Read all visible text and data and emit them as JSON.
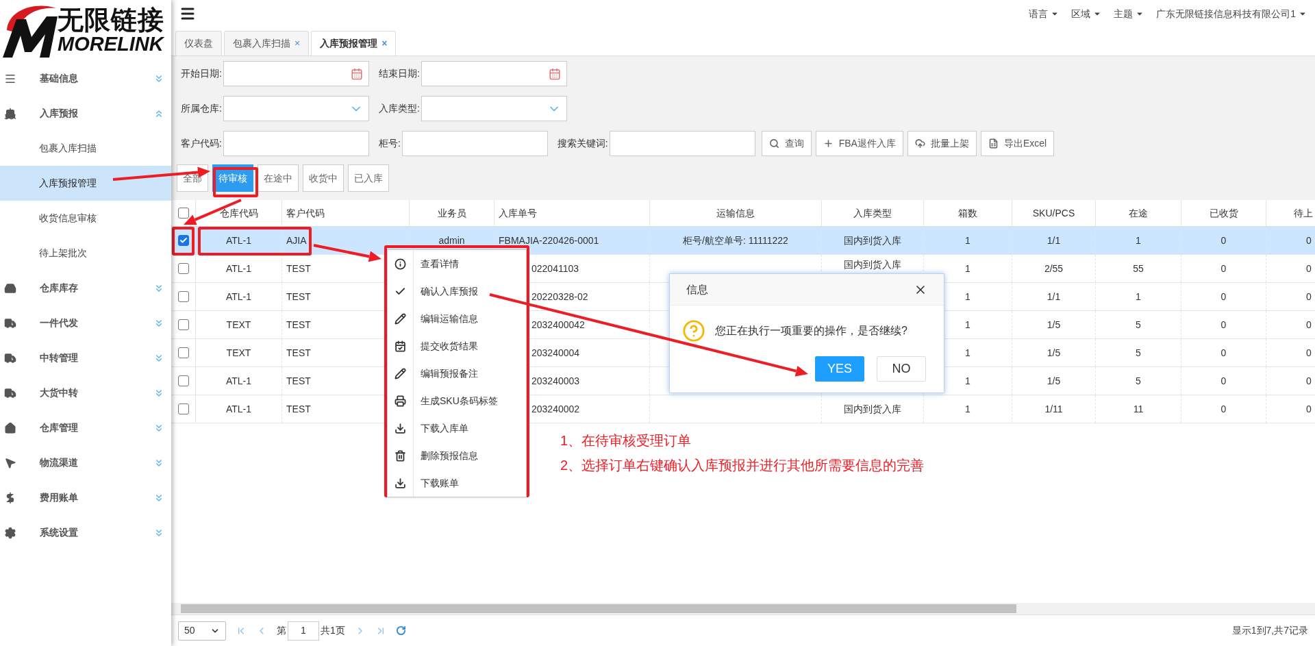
{
  "logo": {
    "title": "无限链接",
    "subtitle": "MORELINK"
  },
  "sidebar": {
    "items": [
      {
        "label": "基础信息",
        "expanded": false
      },
      {
        "label": "入库预报",
        "expanded": true,
        "children": [
          {
            "label": "包裹入库扫描",
            "selected": false
          },
          {
            "label": "入库预报管理",
            "selected": true
          },
          {
            "label": "收货信息审核",
            "selected": false
          },
          {
            "label": "待上架批次",
            "selected": false
          }
        ]
      },
      {
        "label": "仓库库存",
        "expanded": false
      },
      {
        "label": "一件代发",
        "expanded": false
      },
      {
        "label": "中转管理",
        "expanded": false
      },
      {
        "label": "大货中转",
        "expanded": false
      },
      {
        "label": "仓库管理",
        "expanded": false
      },
      {
        "label": "物流渠道",
        "expanded": false
      },
      {
        "label": "费用账单",
        "expanded": false
      },
      {
        "label": "系统设置",
        "expanded": false
      }
    ]
  },
  "top_bar": {
    "menus": [
      "语言",
      "区域",
      "主题",
      "广东无限链接信息科技有限公司1"
    ]
  },
  "tabs": [
    {
      "label": "仪表盘",
      "selected": false
    },
    {
      "label": "包裹入库扫描",
      "close": "×",
      "selected": false
    },
    {
      "label": "入库预报管理",
      "close": "×",
      "selected": true
    }
  ],
  "filter_rows": [
    [
      {
        "label": "开始日期:",
        "kind": "date"
      },
      {
        "label": "结束日期:",
        "kind": "date"
      }
    ],
    [
      {
        "label": "所属仓库:",
        "kind": "select"
      },
      {
        "label": "入库类型:",
        "kind": "select"
      }
    ],
    [
      {
        "label": "客户代码:",
        "kind": "text"
      },
      {
        "label": "柜号:",
        "kind": "text"
      },
      {
        "label": "搜索关键词:",
        "kind": "text"
      }
    ]
  ],
  "actions": [
    "查询",
    "FBA退件入库",
    "批量上架",
    "导出Excel"
  ],
  "status_tabs": [
    {
      "label": "全部",
      "selected": false
    },
    {
      "label": "待审核",
      "selected": true
    },
    {
      "label": "在途中",
      "selected": false
    },
    {
      "label": "收货中",
      "selected": false
    },
    {
      "label": "已入库",
      "selected": false
    }
  ],
  "table": {
    "header_checked": false,
    "columns": [
      "仓库代码",
      "客户代码",
      "业务员",
      "入库单号",
      "运输信息",
      "入库类型",
      "箱数",
      "SKU/PCS",
      "在途",
      "已收货",
      "待上"
    ],
    "rows": [
      {
        "checked": true,
        "selected": true,
        "warehouse": "ATL-1",
        "customer": "AJIA",
        "staff": "admin",
        "order_no": "FBMAJIA-220426-0001",
        "transport": "柜号/航空单号: 11111222",
        "type": "国内到货入库",
        "boxes": "1",
        "sku_pcs": "1/1",
        "in_transit": "1",
        "received": "0",
        "pending": "0"
      },
      {
        "checked": false,
        "selected": false,
        "warehouse": "ATL-1",
        "customer": "TEST",
        "order_no": "022041103",
        "type": "国内到货入库",
        "boxes": "1",
        "sku_pcs": "2/55",
        "in_transit": "55",
        "received": "0",
        "pending": "0"
      },
      {
        "checked": false,
        "selected": false,
        "warehouse": "ATL-1",
        "customer": "TEST",
        "order_no": "20220328-02",
        "boxes": "1",
        "sku_pcs": "1/1",
        "in_transit": "1",
        "received": "0",
        "pending": "0"
      },
      {
        "checked": false,
        "selected": false,
        "warehouse": "TEXT",
        "customer": "TEST",
        "order_no": "2032400042",
        "boxes": "1",
        "sku_pcs": "1/5",
        "in_transit": "5",
        "received": "0",
        "pending": "0"
      },
      {
        "checked": false,
        "selected": false,
        "warehouse": "TEXT",
        "customer": "TEST",
        "order_no": "203240004",
        "boxes": "1",
        "sku_pcs": "1/5",
        "in_transit": "5",
        "received": "0",
        "pending": "0"
      },
      {
        "checked": false,
        "selected": false,
        "warehouse": "ATL-1",
        "customer": "TEST",
        "order_no": "203240003",
        "boxes": "1",
        "sku_pcs": "1/5",
        "in_transit": "5",
        "received": "0",
        "pending": "0"
      },
      {
        "checked": false,
        "selected": false,
        "warehouse": "ATL-1",
        "customer": "TEST",
        "order_no": "203240002",
        "type": "国内到货入库",
        "boxes": "1",
        "sku_pcs": "1/11",
        "in_transit": "11",
        "received": "0",
        "pending": "0"
      }
    ]
  },
  "context_menu": {
    "items": [
      "查看详情",
      "确认入库预报",
      "编辑运输信息",
      "提交收货结果",
      "编辑预报备注",
      "生成SKU条码标签",
      "下载入库单",
      "删除预报信息",
      "下载账单"
    ]
  },
  "dialog": {
    "title": "信息",
    "message": "您正在执行一项重要的操作，是否继续?",
    "buttons": [
      {
        "label": "YES",
        "primary": true
      },
      {
        "label": "NO",
        "primary": false
      }
    ]
  },
  "notes": [
    "1、在待审核受理订单",
    "2、选择订单右键确认入库预报并进行其他所需要信息的完善"
  ],
  "pager": {
    "page_size": "50",
    "page_prefix": "第",
    "page": "1",
    "page_suffix": "共1页",
    "summary": "显示1到7,共7记录"
  }
}
